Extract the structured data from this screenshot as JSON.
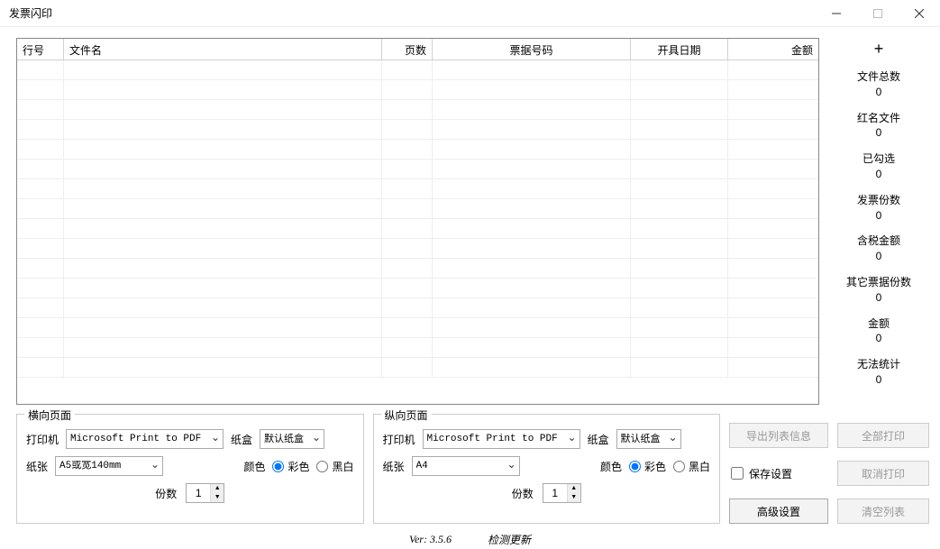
{
  "window": {
    "title": "发票闪印"
  },
  "table": {
    "columns": {
      "row": "行号",
      "filename": "文件名",
      "pages": "页数",
      "billno": "票据号码",
      "date": "开具日期",
      "amount": "金额"
    }
  },
  "side": {
    "plus": "+",
    "stats": [
      {
        "label": "文件总数",
        "value": "0"
      },
      {
        "label": "红名文件",
        "value": "0"
      },
      {
        "label": "已勾选",
        "value": "0"
      },
      {
        "label": "发票份数",
        "value": "0"
      },
      {
        "label": "含税金额",
        "value": "0"
      },
      {
        "label": "其它票据份数",
        "value": "0"
      },
      {
        "label": "金额",
        "value": "0"
      },
      {
        "label": "无法统计",
        "value": "0"
      }
    ]
  },
  "landscape": {
    "legend": "横向页面",
    "printer_label": "打印机",
    "printer_value": "Microsoft Print to PDF",
    "tray_label": "纸盒",
    "tray_value": "默认纸盒",
    "paper_label": "纸张",
    "paper_value": "A5或宽140mm",
    "color_label": "颜色",
    "color_opt": "彩色",
    "bw_opt": "黑白",
    "copies_label": "份数",
    "copies_value": "1"
  },
  "portrait": {
    "legend": "纵向页面",
    "printer_label": "打印机",
    "printer_value": "Microsoft Print to PDF",
    "tray_label": "纸盒",
    "tray_value": "默认纸盒",
    "paper_label": "纸张",
    "paper_value": "A4",
    "color_label": "颜色",
    "color_opt": "彩色",
    "bw_opt": "黑白",
    "copies_label": "份数",
    "copies_value": "1"
  },
  "buttons": {
    "export": "导出列表信息",
    "save_settings": "保存设置",
    "advanced": "高级设置",
    "print_all": "全部打印",
    "cancel_print": "取消打印",
    "clear_list": "清空列表"
  },
  "status": {
    "version": "Ver: 3.5.6",
    "update": "检测更新"
  }
}
